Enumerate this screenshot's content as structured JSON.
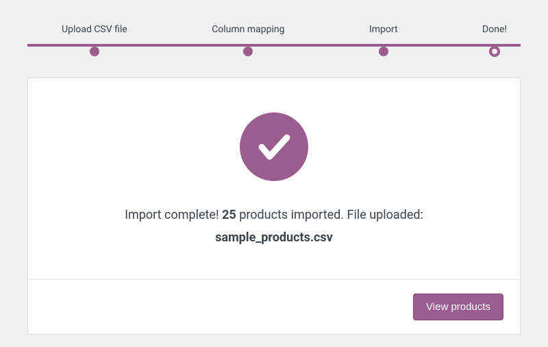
{
  "stepper": {
    "steps": [
      {
        "label": "Upload CSV file",
        "state": "done"
      },
      {
        "label": "Column mapping",
        "state": "done"
      },
      {
        "label": "Import",
        "state": "done"
      },
      {
        "label": "Done!",
        "state": "current"
      }
    ]
  },
  "result": {
    "message_prefix": "Import complete! ",
    "count": "25",
    "message_suffix": " products imported. File uploaded:",
    "filename": "sample_products.csv"
  },
  "actions": {
    "view_products_label": "View products"
  },
  "colors": {
    "accent": "#9b5c8f"
  }
}
